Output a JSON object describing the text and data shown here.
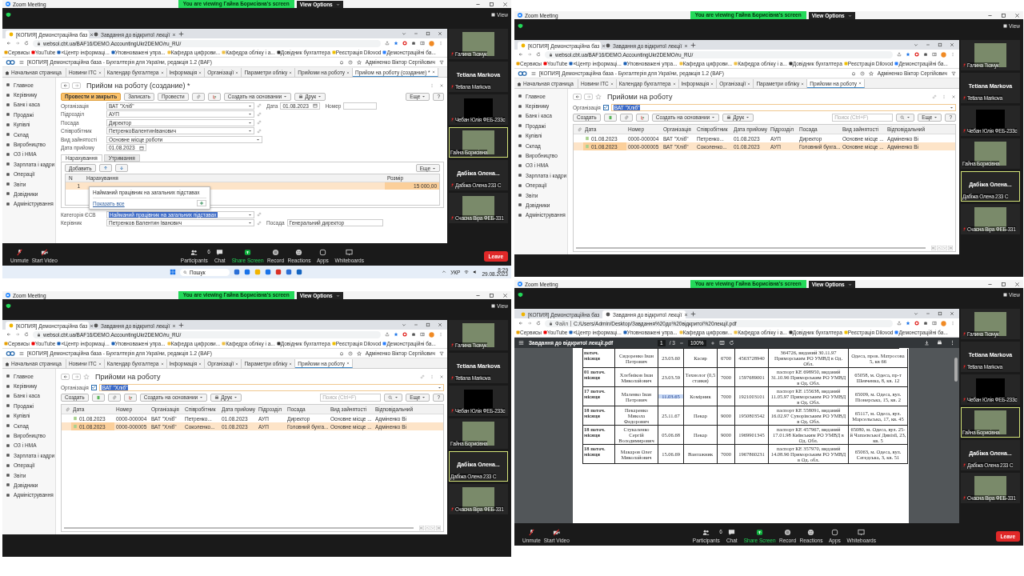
{
  "panels": [
    {
      "zoom": {
        "title": "Zoom Meeting",
        "banner": "You are viewing Гайна Борисівна's screen",
        "view_options": "View Options",
        "view": "View"
      },
      "browser": {
        "tabs": [
          {
            "label": "[КОПИЯ] Демонстраційна баз",
            "selected": true
          },
          {
            "label": "Завдання до відкритої лекції",
            "selected": false
          }
        ],
        "url": "websol.cbt.ua/BAF16/DEMO.AccountingUkr2DEMO/ru_RU/",
        "bookmarks": [
          "Сервисы",
          "YouTube",
          "«Центр інформаці...",
          "Уповноважені упра...",
          "Кафедра цифрови...",
          "Кафедра обліку і а...",
          "Довідник бухгалтера",
          "Реєстрація Dilovod",
          "Демонстраційні ба..."
        ]
      },
      "app": {
        "kind": "accounting",
        "title": "[КОПИЯ] Демонстраційна база - Бухгалтерія для України, редакція 1.2  (BAF)",
        "user": "Адміненко Віктор Сергійович",
        "home": "Начальная страница",
        "tabs": [
          {
            "label": "Новини ІТС",
            "selected": false
          },
          {
            "label": "Календар бухгалтера",
            "selected": false
          },
          {
            "label": "Інформація",
            "selected": false
          },
          {
            "label": "Організації",
            "selected": false
          },
          {
            "label": "Параметри обліку",
            "selected": false
          },
          {
            "label": "Прийоми на роботу",
            "selected": false
          },
          {
            "label": "Прийом на роботу (создание) *",
            "selected": true
          }
        ],
        "sidebar": [
          "Главное",
          "Керівнику",
          "Банк і каса",
          "Продажі",
          "Купівлі",
          "Склад",
          "Виробництво",
          "ОЗ і НМА",
          "Зарплата і кадри",
          "Операції",
          "Звіти",
          "Довідники",
          "Адміністрування"
        ],
        "page": {
          "kind": "form",
          "title": "Прийом на роботу (создание) *",
          "buttons": [
            {
              "label": "Провести и закрыть",
              "primary": true
            },
            {
              "label": "Записать",
              "primary": false
            },
            {
              "label": "Провести",
              "primary": false
            }
          ],
          "create_based": "Создать на основании",
          "print": "Друк",
          "more": "Еще",
          "help": "?",
          "fields": [
            {
              "label": "Організація",
              "value": "ВАТ \"Хліб\"",
              "kind": "select",
              "extra": [
                {
                  "label": "Дата",
                  "value": "01.08.2023",
                  "kind": "date"
                },
                {
                  "label": "Номер",
                  "kind": "text"
                }
              ]
            },
            {
              "label": "Підрозділ",
              "value": "АУП",
              "kind": "select"
            },
            {
              "label": "Посада",
              "value": "Директор",
              "kind": "select"
            },
            {
              "label": "Співробітник",
              "value": "ПетренкоВалентинІванович",
              "kind": "select"
            },
            {
              "label": "Вид зайнятості",
              "value": "Основне місце роботи",
              "kind": "choice"
            },
            {
              "label": "Дата прийому",
              "value": "01.08.2023",
              "kind": "date"
            }
          ],
          "subtabs": [
            {
              "label": "Нарахування",
              "selected": true
            },
            {
              "label": "Утримання",
              "selected": false
            }
          ],
          "add": "Добавить",
          "table_more": "Еще",
          "columns": [
            "N",
            "Нарахування",
            "Розмір"
          ],
          "rows": [
            {
              "n": "1",
              "amount": "15 000,00"
            }
          ],
          "popup": {
            "item": "Найманий працівник на загальних підставах",
            "show_all": "Показать все"
          },
          "bottom_fields": [
            {
              "label": "Категорія ЄСВ",
              "value": "Найманий працівник на загальних підставах",
              "selected": true
            },
            {
              "label": "Керівник",
              "value": "Петренков Валентин Іванович",
              "selected": false,
              "extra": [
                {
                  "label": "Посада",
                  "value": "Генеральний директор"
                }
              ]
            }
          ]
        }
      },
      "participants": [
        {
          "kind": "video",
          "label": "Галина Ткачук",
          "muted": true,
          "active": false
        },
        {
          "kind": "name",
          "name": "Tetiana Markova",
          "label": "Tetiana Markova",
          "muted": true,
          "active": false
        },
        {
          "kind": "dark",
          "label": "Чебан Юлія ФЕБ-233с",
          "muted": true,
          "active": false
        },
        {
          "kind": "video",
          "label": "Гайна Борисівна",
          "muted": false,
          "active": true
        },
        {
          "kind": "name",
          "name": "Дабіжа Олена...",
          "label": "Дабіжа Олена 233 С",
          "muted": true,
          "active": false
        },
        {
          "kind": "video",
          "label": "Счасна Віра ФЕБ-331",
          "muted": true,
          "active": false
        }
      ],
      "toolbar": {
        "items": [
          {
            "kind": "mic",
            "label": "Unmute"
          },
          {
            "kind": "video",
            "label": "Start Video"
          },
          {
            "kind": "people",
            "label": "Participants",
            "count": "6"
          },
          {
            "kind": "chat",
            "label": "Chat"
          },
          {
            "kind": "share",
            "label": "Share Screen"
          },
          {
            "kind": "record",
            "label": "Record"
          },
          {
            "kind": "reactions",
            "label": "Reactions"
          },
          {
            "kind": "apps",
            "label": "Apps"
          },
          {
            "kind": "whiteboard",
            "label": "Whiteboards"
          }
        ],
        "leave": "Leave"
      },
      "taskbar": {
        "search": "Пошук",
        "lang": "УКР",
        "time": "8:29",
        "date": "29.08.2023"
      }
    },
    {
      "zoom": {
        "title": "Zoom Meeting",
        "banner": "You are viewing Гайна Борисівна's screen",
        "view_options": "View Options",
        "view": "View"
      },
      "browser": {
        "tabs": [
          {
            "label": "[КОПИЯ] Демонстраційна баз",
            "selected": true
          },
          {
            "label": "Завдання до відкритої лекції",
            "selected": false
          }
        ],
        "url": "websol.cbt.ua/BAF16/DEMO.AccountingUkr2DEMO/ru_RU/",
        "bookmarks": [
          "Сервисы",
          "YouTube",
          "«Центр інформаці...",
          "Уповноважені упра...",
          "Кафедра цифрови...",
          "Кафедра обліку і а...",
          "Довідник бухгалтера",
          "Реєстрація Dilovod",
          "Демонстраційні ба..."
        ]
      },
      "app": {
        "kind": "accounting",
        "title": "[КОПИЯ] Демонстраційна база - Бухгалтерія для України, редакція 1.2  (BAF)",
        "user": "Адміненко Віктор Сергійович",
        "home": "Начальная страница",
        "tabs": [
          {
            "label": "Новини ІТС",
            "selected": false
          },
          {
            "label": "Календар бухгалтера",
            "selected": false
          },
          {
            "label": "Інформація",
            "selected": false
          },
          {
            "label": "Організації",
            "selected": false
          },
          {
            "label": "Параметри обліку",
            "selected": false
          },
          {
            "label": "Прийоми на роботу",
            "selected": true
          }
        ],
        "sidebar": [
          "Главное",
          "Керівнику",
          "Банк і каса",
          "Продажі",
          "Купівлі",
          "Склад",
          "Виробництво",
          "ОЗ і НМА",
          "Зарплата і кадри",
          "Операції",
          "Звіти",
          "Довідники",
          "Адміністрування"
        ],
        "page": {
          "kind": "list",
          "title": "Прийоми на роботу",
          "filter": {
            "label": "Організація",
            "checked": true,
            "value": "ВАТ \"Хліб\"",
            "selected": true
          },
          "create": "Создать",
          "create_based": "Создать на основании",
          "print": "Друк",
          "search_placeholder": "Поиск (Ctrl+F)",
          "more": "Еще",
          "help": "?",
          "columns": [
            "Дата",
            "Номер",
            "Організація",
            "Співробітник",
            "Дата прийому",
            "Підрозділ",
            "Посада",
            "Вид зайнятості",
            "Відповідальний"
          ],
          "rows": [
            {
              "cells": [
                "01.08.2023",
                "0000-000004",
                "ВАТ \"Хліб\"",
                "Петренко...",
                "01.08.2023",
                "АУП",
                "Директор",
                "Основне місце ...",
                "Адміненко Ві"
              ],
              "selected": false
            },
            {
              "cells": [
                "01.08.2023",
                "0000-000005",
                "ВАТ \"Хліб\"",
                "Соколенко...",
                "01.08.2023",
                "АУП",
                "Головний бухга...",
                "Основне місце ...",
                "Адміненко Ві"
              ],
              "selected": true
            }
          ]
        }
      },
      "participants": [
        {
          "kind": "video",
          "label": "Галина Ткачук",
          "muted": true,
          "active": false
        },
        {
          "kind": "name",
          "name": "Tetiana Markova",
          "label": "Tetiana Markova",
          "muted": true,
          "active": false
        },
        {
          "kind": "dark",
          "label": "Чебан Юлія ФЕБ-233с",
          "muted": true,
          "active": false
        },
        {
          "kind": "video",
          "label": "Гайна Борисівна",
          "muted": false,
          "active": false
        },
        {
          "kind": "name",
          "name": "Дабіжа Олена...",
          "label": "Дабіжа Олена 233 С",
          "muted": false,
          "active": true
        },
        {
          "kind": "video",
          "label": "Счасна Віра ФЕБ-331",
          "muted": true,
          "active": false
        }
      ]
    },
    {
      "zoom": {
        "title": "Zoom Meeting",
        "banner": "You are viewing Гайна Борисівна's screen",
        "view_options": "View Options",
        "view": "View"
      },
      "browser": {
        "tabs": [
          {
            "label": "[КОПИЯ] Демонстраційна баз",
            "selected": true
          },
          {
            "label": "Завдання до відкритої лекції",
            "selected": false
          }
        ],
        "url": "websol.cbt.ua/BAF16/DEMO.AccountingUkr2DEMO/ru_RU/",
        "bookmarks": [
          "Сервисы",
          "YouTube",
          "«Центр інформаці...",
          "Уповноважені упра...",
          "Кафедра цифрови...",
          "Кафедра обліку і а...",
          "Довідник бухгалтера",
          "Реєстрація Dilovod",
          "Демонстраційні ба..."
        ]
      },
      "app": {
        "kind": "accounting",
        "title": "[КОПИЯ] Демонстраційна база - Бухгалтерія для України, редакція 1.2  (BAF)",
        "user": "Адміненко Віктор Сергійович",
        "home": "Начальная страница",
        "tabs": [
          {
            "label": "Новини ІТС",
            "selected": false
          },
          {
            "label": "Календар бухгалтера",
            "selected": false
          },
          {
            "label": "Інформація",
            "selected": false
          },
          {
            "label": "Організації",
            "selected": false
          },
          {
            "label": "Параметри обліку",
            "selected": false
          },
          {
            "label": "Прийоми на роботу",
            "selected": true
          }
        ],
        "sidebar": [
          "Главное",
          "Керівнику",
          "Банк і каса",
          "Продажі",
          "Купівлі",
          "Склад",
          "Виробництво",
          "ОЗ і НМА",
          "Зарплата і кадри",
          "Операції",
          "Звіти",
          "Довідники",
          "Адміністрування"
        ],
        "page": {
          "kind": "list",
          "title": "Прийоми на роботу",
          "filter": {
            "label": "Організація",
            "checked": true,
            "value": "ВАТ \"Хліб\"",
            "selected": true
          },
          "create": "Создать",
          "create_based": "Создать на основании",
          "print": "Друк",
          "search_placeholder": "Поиск (Ctrl+F)",
          "more": "Еще",
          "help": "?",
          "columns": [
            "Дата",
            "Номер",
            "Організація",
            "Співробітник",
            "Дата прийому",
            "Підрозділ",
            "Посада",
            "Вид зайнятості",
            "Відповідальний"
          ],
          "rows": [
            {
              "cells": [
                "01.08.2023",
                "0000-000004",
                "ВАТ \"Хліб\"",
                "Петренко...",
                "01.08.2023",
                "АУП",
                "Директор",
                "Основне місце ...",
                "Адміненко Ві"
              ],
              "selected": false
            },
            {
              "cells": [
                "01.08.2023",
                "0000-000005",
                "ВАТ \"Хліб\"",
                "Соколенко...",
                "01.08.2023",
                "АУП",
                "Головний бухга...",
                "Основне місце ...",
                "Адміненко Ві"
              ],
              "selected": true
            }
          ]
        }
      },
      "participants": [
        {
          "kind": "video",
          "label": "Галина Ткачук",
          "muted": true,
          "active": false
        },
        {
          "kind": "name",
          "name": "Tetiana Markova",
          "label": "Tetiana Markova",
          "muted": true,
          "active": false
        },
        {
          "kind": "dark",
          "label": "Чебан Юлія ФЕБ-233с",
          "muted": true,
          "active": false
        },
        {
          "kind": "video",
          "label": "Гайна Борисівна",
          "muted": false,
          "active": false
        },
        {
          "kind": "name",
          "name": "Дабіжа Олена...",
          "label": "Дабіжа Олена 233 С",
          "muted": false,
          "active": true
        },
        {
          "kind": "video",
          "label": "Счасна Віра ФЕБ-331",
          "muted": true,
          "active": false
        }
      ]
    },
    {
      "zoom": {
        "title": "Zoom Meeting",
        "banner": "You are viewing Гайна Борисівна's screen",
        "view_options": "View Options",
        "view": "View"
      },
      "browser": {
        "tabs": [
          {
            "label": "[КОПИЯ] Демонстраційна баз",
            "selected": false
          },
          {
            "label": "Завдання до відкритої лекції",
            "selected": true
          }
        ],
        "url_prefix": "Файл",
        "url": "C:/Users/Admin/Desktop/Завдання%20до%20відкритої%20лекції.pdf",
        "bookmarks": [
          "Сервисы",
          "YouTube",
          "«Центр інформаці...",
          "Уповноважені упра...",
          "Кафедра цифрови...",
          "Кафедра обліку і а...",
          "Довідник бухгалтера",
          "Реєстрація Dilovod",
          "Демонстраційні ба..."
        ]
      },
      "app": {
        "kind": "pdf",
        "title": "Завдання до відкритої лекції.pdf",
        "page": "1",
        "pages": "/ 3",
        "zoom": "100%",
        "rows": [
          {
            "cells": [
              "поточ. місяця",
              "Сидоренко Іван Петрович",
              "23.03.60",
              "Касир",
              "6700",
              "4563728940",
              "364726, виданий 30.11.97 Приморським РО УМВД в Од. Обл.",
              "Одеса, пров. Матросова 5, кв 66"
            ],
            "date_selected": false
          },
          {
            "cells": [
              "01 поточ. місяця",
              "Хлєбніков Іван Миколайович",
              "23.03.59",
              "Технолог (0,5 ставки)",
              "7000",
              "1597689001",
              "паспорт КЕ 698950, виданий 31.10.96 Приморським РО УМВД в Од. Обл.",
              "65058, м. Одеса, пр-т Шевченка, 8, кв. 12"
            ],
            "date_selected": false
          },
          {
            "cells": [
              "17 поточ. місяця",
              "Маленко Іван Петрович",
              "11.03.65",
              "Комірник",
              "7000",
              "1921003101",
              "паспорт КЕ 155638, виданий 11.05.97 Приморським РО УМВД в Од. Обл.",
              "65009, м. Одеса, вул. Піонерська, 15, кв. 2"
            ],
            "date_selected": true
          },
          {
            "cells": [
              "18 поточ. місяця",
              "Пекаренко Микола Федорович",
              "25.11.67",
              "Пекар",
              "9000",
              "1950803542",
              "паспорт КЕ 558091, виданий 16.02.97 Суворівським РО УМВД в Од. Обл.",
              "65117, м. Одеса, вул. Марсельська, 17, кв. 45"
            ],
            "date_selected": false
          },
          {
            "cells": [
              "18 поточ. місяця",
              "Стукаленко Сергій Володимирович",
              "05.06.68",
              "Пекар",
              "9000",
              "1969901345",
              "паспорт КЕ 457967, виданий 17.01.98 Київським РО УМВД в Од. Обл.",
              "65080, м. Одеса, вул. 25-й Чапаєвської Дивізії, 23, кв. 5"
            ],
            "date_selected": false
          },
          {
            "cells": [
              "18 поточ. місяця",
              "Макаров Олег Миколайович",
              "15.06.69",
              "Вантажник",
              "7000",
              "1967860231",
              "паспорт КЕ 357970, виданий 14.08.96 Приморським РО УМВД в Од. обл.",
              "65063, м. Одеса, вул. Сегедська, 3, кв. 51"
            ],
            "date_selected": false
          }
        ]
      },
      "participants": [
        {
          "kind": "video",
          "label": "Галина Ткачук",
          "muted": true,
          "active": false
        },
        {
          "kind": "name",
          "name": "Tetiana Markova",
          "label": "Tetiana Markova",
          "muted": true,
          "active": false
        },
        {
          "kind": "dark",
          "label": "Чебан Юлія ФЕБ-233с",
          "muted": true,
          "active": false
        },
        {
          "kind": "video",
          "label": "Гайна Борисівна",
          "muted": false,
          "active": true
        },
        {
          "kind": "name",
          "name": "Дабіжа Олена...",
          "label": "Дабіжа Олена 233 С",
          "muted": true,
          "active": false
        },
        {
          "kind": "video",
          "label": "Счасна Віра ФЕБ-331",
          "muted": true,
          "active": false
        }
      ],
      "toolbar": {
        "items": [
          {
            "kind": "mic",
            "label": "Unmute"
          },
          {
            "kind": "video",
            "label": "Start Video"
          },
          {
            "kind": "people",
            "label": "Participants",
            "count": "6"
          },
          {
            "kind": "chat",
            "label": "Chat"
          },
          {
            "kind": "share",
            "label": "Share Screen"
          },
          {
            "kind": "record",
            "label": "Record"
          },
          {
            "kind": "reactions",
            "label": "Reactions"
          },
          {
            "kind": "apps",
            "label": "Apps"
          },
          {
            "kind": "whiteboard",
            "label": "Whiteboards"
          }
        ],
        "leave": "Leave"
      }
    }
  ]
}
